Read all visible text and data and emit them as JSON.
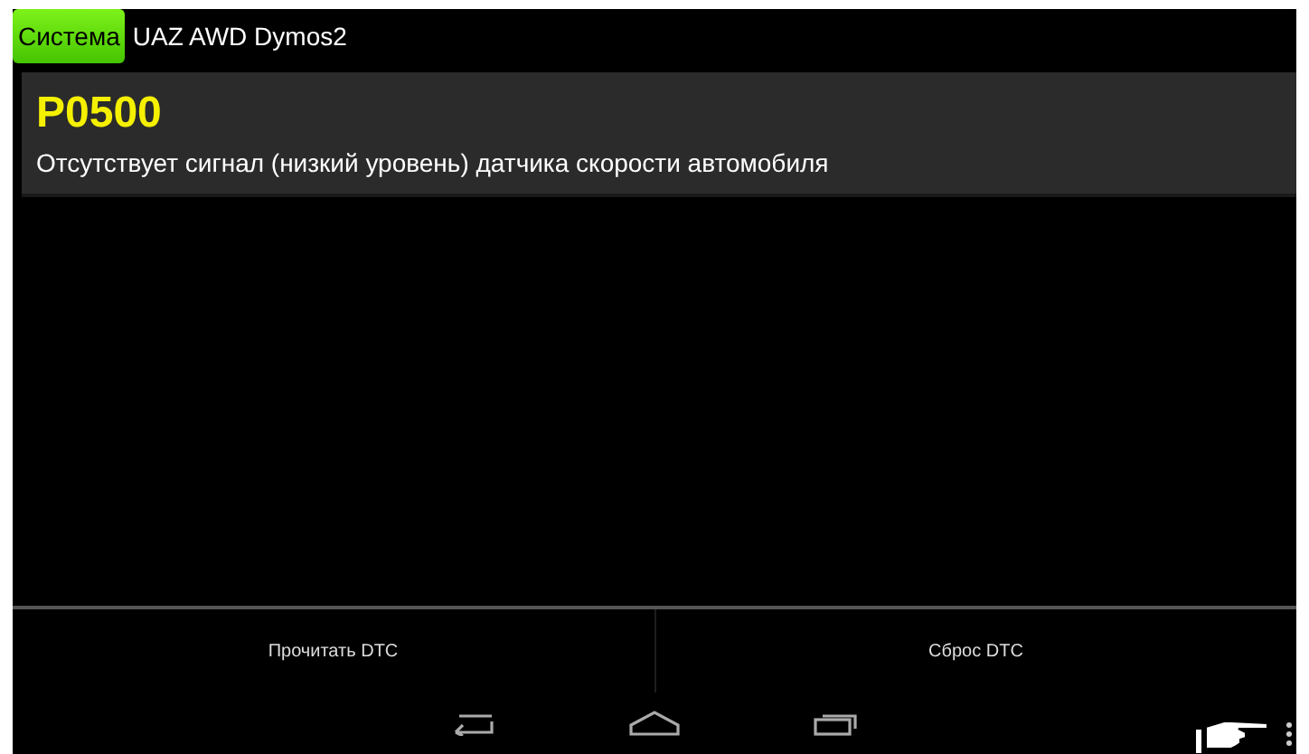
{
  "top_bar": {
    "system_button": "Система",
    "title": "UAZ AWD Dymos2"
  },
  "dtc_list": [
    {
      "code": "P0500",
      "description": "Отсутствует сигнал (низкий уровень) датчика скорости автомобиля"
    }
  ],
  "actions": [
    "Прочитать DTC",
    "Сброс DTC"
  ]
}
